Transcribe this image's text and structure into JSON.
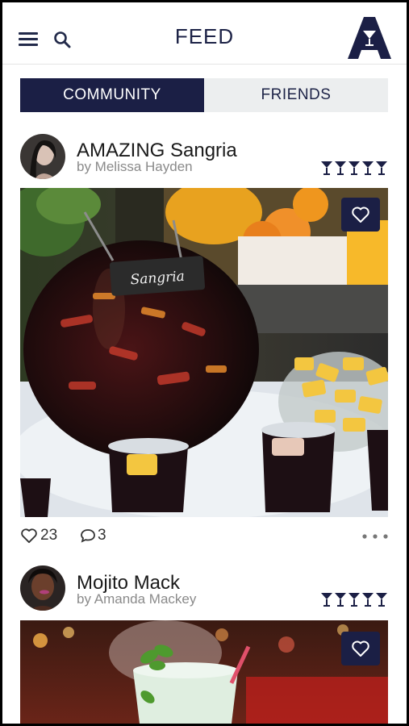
{
  "header": {
    "title": "FEED",
    "menu_icon": "hamburger-menu-icon",
    "search_icon": "search-icon",
    "logo": "martini-a-logo"
  },
  "tabs": [
    {
      "label": "COMMUNITY",
      "active": true
    },
    {
      "label": "FRIENDS",
      "active": false
    }
  ],
  "posts": [
    {
      "title": "AMAZING Sangria",
      "author": "by Melissa Hayden",
      "rating_icons": 5,
      "likes": "23",
      "comments": "3",
      "photo_sign": "Sangria"
    },
    {
      "title": "Mojito Mack",
      "author": "by Amanda Mackey",
      "rating_icons": 5
    }
  ],
  "colors": {
    "navy": "#1b1f45",
    "tab_inactive": "#eceeef",
    "author_gray": "#8a8a8a"
  }
}
